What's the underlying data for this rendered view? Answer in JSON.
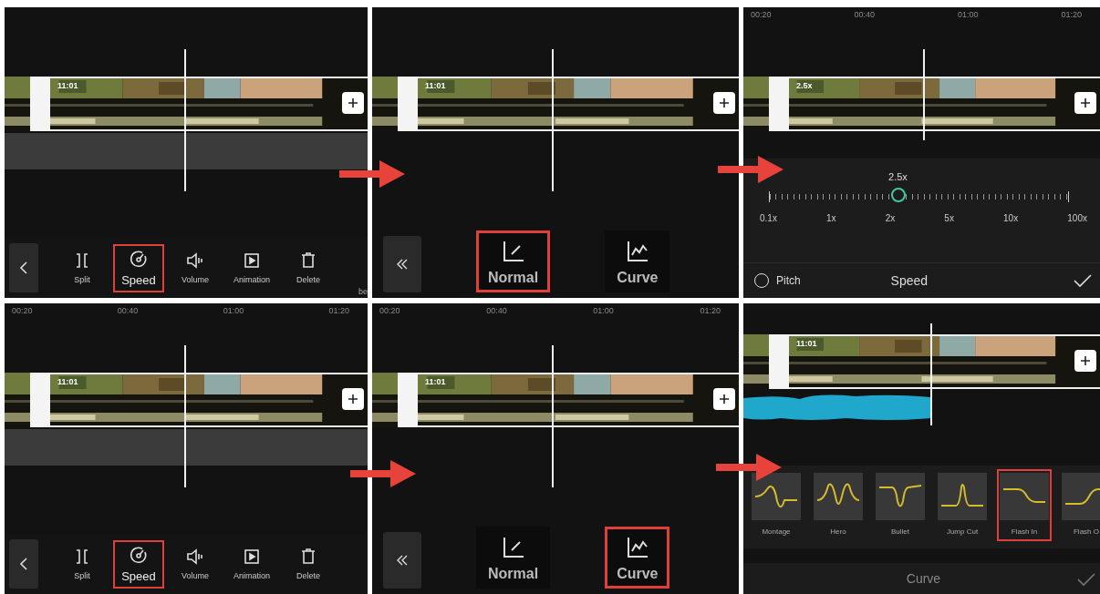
{
  "panels": [
    {
      "kind": "tools",
      "clip_label": "11:01",
      "tools": [
        {
          "label": "Split",
          "selected": false
        },
        {
          "label": "Speed",
          "selected": true
        },
        {
          "label": "Volume",
          "selected": false
        },
        {
          "label": "Animation",
          "selected": false
        },
        {
          "label": "Delete",
          "selected": false
        }
      ],
      "edge_text": "be"
    },
    {
      "kind": "modes",
      "clip_label": "11:01",
      "modes": [
        {
          "label": "Normal",
          "selected": true
        },
        {
          "label": "Curve",
          "selected": false
        }
      ]
    },
    {
      "kind": "speed",
      "ruler": [
        "00:20",
        "00:40",
        "01:00",
        "01:20"
      ],
      "clip_label": "2.5x",
      "reading": "2.5x",
      "level": 0.43,
      "ticks": [
        "0.1x",
        "1x",
        "2x",
        "5x",
        "10x",
        "100x"
      ],
      "pitch": {
        "label": "Pitch",
        "checked": false
      },
      "title": "Speed"
    },
    {
      "kind": "tools",
      "ruler": [
        "00:20",
        "00:40",
        "01:00",
        "01:20"
      ],
      "clip_label": "11:01",
      "tools": [
        {
          "label": "Split",
          "selected": false
        },
        {
          "label": "Speed",
          "selected": true
        },
        {
          "label": "Volume",
          "selected": false
        },
        {
          "label": "Animation",
          "selected": false
        },
        {
          "label": "Delete",
          "selected": false
        }
      ]
    },
    {
      "kind": "modes",
      "ruler": [
        "00:20",
        "00:40",
        "01:00",
        "01:20"
      ],
      "clip_label": "11:01",
      "modes": [
        {
          "label": "Normal",
          "selected": false
        },
        {
          "label": "Curve",
          "selected": true
        }
      ]
    },
    {
      "kind": "curve",
      "clip_label": "11:01",
      "presets": [
        {
          "label": "Montage",
          "selected": false
        },
        {
          "label": "Hero",
          "selected": false
        },
        {
          "label": "Bullet",
          "selected": false
        },
        {
          "label": "Jump Cut",
          "selected": false
        },
        {
          "label": "Flash In",
          "selected": true
        },
        {
          "label": "Flash O",
          "selected": false
        }
      ],
      "title": "Curve"
    }
  ]
}
